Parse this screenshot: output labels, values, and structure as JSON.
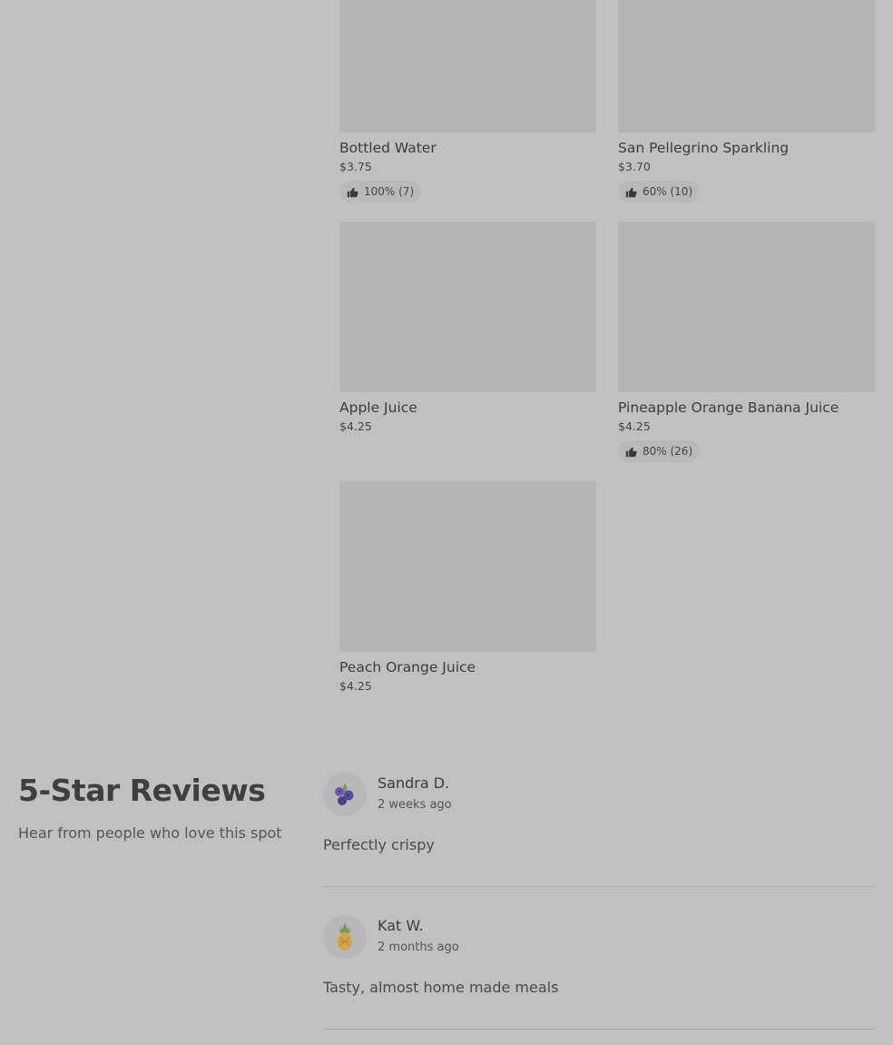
{
  "items": [
    {
      "name": "Bottled Water",
      "price": "$3.75",
      "rating": "100% (7)"
    },
    {
      "name": "San Pellegrino Sparkling",
      "price": "$3.70",
      "rating": "60% (10)"
    },
    {
      "name": "Apple Juice",
      "price": "$4.25",
      "rating": ""
    },
    {
      "name": "Pineapple Orange Banana Juice",
      "price": "$4.25",
      "rating": "80% (26)"
    },
    {
      "name": "Peach Orange Juice",
      "price": "$4.25",
      "rating": ""
    }
  ],
  "reviews_section": {
    "title": "5-Star Reviews",
    "subtitle": "Hear from people who love this spot"
  },
  "reviews": [
    {
      "author": "Sandra D.",
      "when": "2 weeks ago",
      "text": "Perfectly crispy",
      "avatar_icon": "blueberry-icon"
    },
    {
      "author": "Kat W.",
      "when": "2 months ago",
      "text": "Tasty, almost home made meals",
      "avatar_icon": "pineapple-icon"
    }
  ],
  "colors": {
    "background": "#c0c0c0",
    "image_placeholder": "#b4b4b4",
    "rating_pill": "#b9b9b9"
  }
}
